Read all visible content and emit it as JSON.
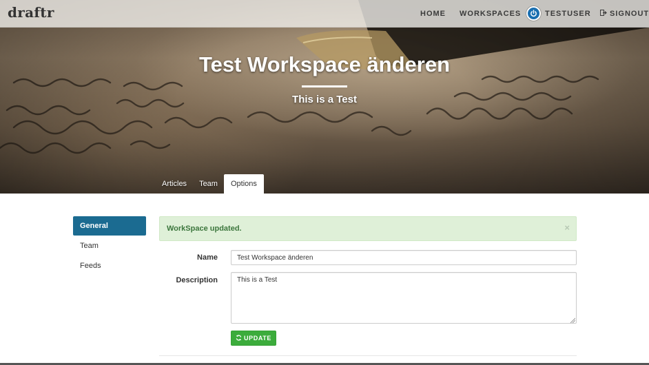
{
  "navbar": {
    "brand": "draftr",
    "links": {
      "home": "HOME",
      "workspaces": "WORKSPACES",
      "user": "TESTUSER",
      "signout": "SIGNOUT"
    }
  },
  "hero": {
    "title": "Test Workspace änderen",
    "subtitle": "This is a Test"
  },
  "tabs": [
    {
      "label": "Articles"
    },
    {
      "label": "Team"
    },
    {
      "label": "Options",
      "active": true
    }
  ],
  "sidebar": {
    "items": [
      {
        "label": "General",
        "active": true
      },
      {
        "label": "Team"
      },
      {
        "label": "Feeds"
      }
    ]
  },
  "alert": {
    "message": "WorkSpace updated.",
    "close": "×"
  },
  "form": {
    "name_label": "Name",
    "name_value": "Test Workspace änderen",
    "description_label": "Description",
    "description_value": "This is a Test",
    "update_label": "UPDATE"
  },
  "colors": {
    "sidebar_active": "#1b6b91",
    "alert_bg": "#dff0d8",
    "alert_text": "#3c763d",
    "button": "#3cac3c",
    "user_icon": "#1a6fb0"
  },
  "icons": {
    "user": "power-icon",
    "signout": "signout-icon",
    "update": "refresh-icon",
    "alert_close": "close-icon"
  }
}
